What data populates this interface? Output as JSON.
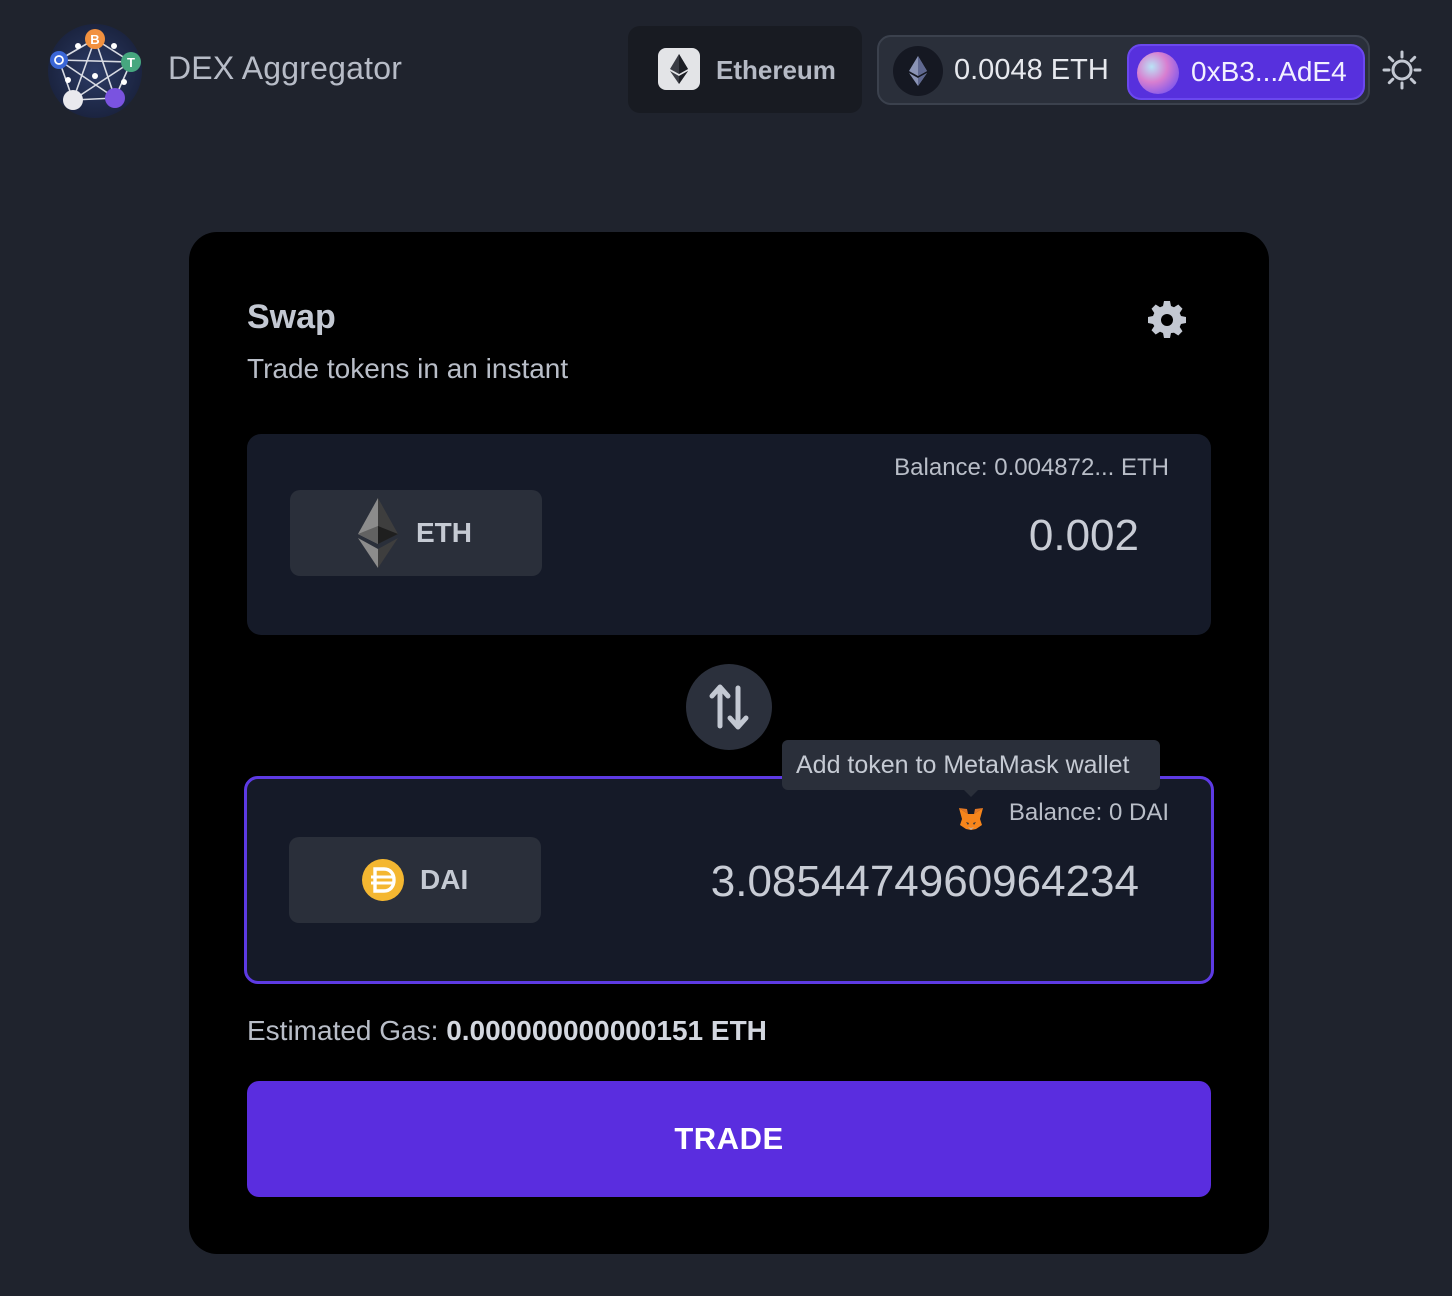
{
  "header": {
    "app_title": "DEX Aggregator",
    "network_label": "Ethereum",
    "account_balance": "0.0048 ETH",
    "address": "0xB3...AdE4"
  },
  "swap": {
    "title": "Swap",
    "subtitle": "Trade tokens in an instant",
    "from": {
      "token_symbol": "ETH",
      "balance": "Balance: 0.004872... ETH",
      "amount": "0.002"
    },
    "to": {
      "token_symbol": "DAI",
      "balance": "Balance: 0 DAI",
      "amount": "3.0854474960964234"
    },
    "tooltip": "Add token to MetaMask wallet",
    "gas_label": "Estimated Gas: ",
    "gas_value": "0.000000000000151 ETH",
    "trade_label": "TRADE"
  },
  "colors": {
    "page_bg": "#1f232d",
    "card_bg": "#000000",
    "panel_bg": "#151a28",
    "accent": "#5a2ddf",
    "dai_orange": "#f4b731"
  },
  "icons": [
    "logo-icon",
    "ethereum-icon",
    "eth-icon",
    "avatar-icon",
    "sun-icon",
    "gear-icon",
    "swap-arrows-icon",
    "dai-icon",
    "metamask-fox-icon"
  ]
}
